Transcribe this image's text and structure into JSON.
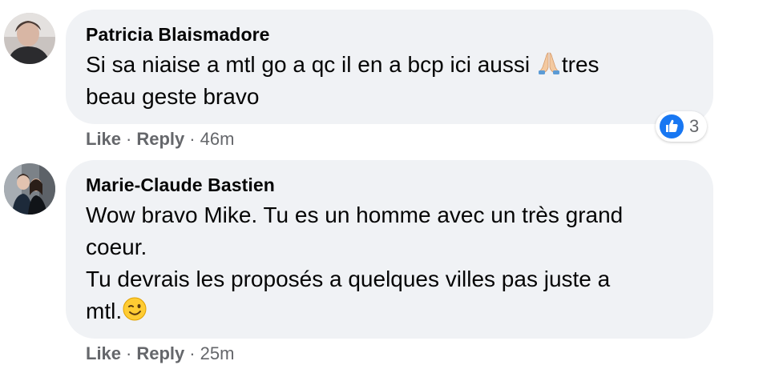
{
  "colors": {
    "bubble_bg": "#f0f2f5",
    "meta_text": "#65676b",
    "like_blue": "#1877f2"
  },
  "comments": [
    {
      "author": "Patricia Blaismadore",
      "lines": [
        "Si sa niaise a mtl go a qc il en a bcp ici aussi ",
        "tres",
        "beau geste bravo"
      ],
      "emoji": "folded-hands-icon",
      "actions": {
        "like": "Like",
        "reply": "Reply",
        "time": "46m"
      },
      "reaction": {
        "icon": "thumbs-up-icon",
        "count": "3"
      }
    },
    {
      "author": "Marie-Claude Bastien",
      "lines": [
        "Wow bravo Mike. Tu es un homme avec un très grand",
        "coeur.",
        "Tu devrais les proposés a quelques villes pas juste a",
        "mtl."
      ],
      "emoji": "winking-face-icon",
      "actions": {
        "like": "Like",
        "reply": "Reply",
        "time": "25m"
      }
    }
  ],
  "separator": "·"
}
